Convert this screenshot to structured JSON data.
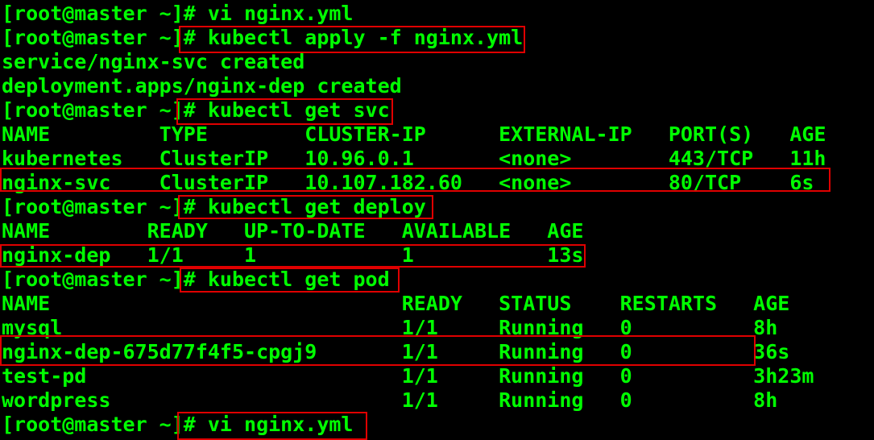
{
  "terminal": {
    "prompt": "[root@master ~]",
    "lines": [
      "[root@master ~]# vi nginx.yml",
      "[root@master ~]# kubectl apply -f nginx.yml",
      "service/nginx-svc created",
      "deployment.apps/nginx-dep created",
      "[root@master ~]# kubectl get svc",
      "NAME         TYPE        CLUSTER-IP      EXTERNAL-IP   PORT(S)   AGE",
      "kubernetes   ClusterIP   10.96.0.1       <none>        443/TCP   11h",
      "nginx-svc    ClusterIP   10.107.182.60   <none>        80/TCP    6s",
      "[root@master ~]# kubectl get deploy",
      "NAME        READY   UP-TO-DATE   AVAILABLE   AGE",
      "nginx-dep   1/1     1            1           13s",
      "[root@master ~]# kubectl get pod",
      "NAME                             READY   STATUS    RESTARTS   AGE",
      "mysql                            1/1     Running   0          8h",
      "nginx-dep-675d77f4f5-cpgj9       1/1     Running   0          36s",
      "test-pd                          1/1     Running   0          3h23m",
      "wordpress                        1/1     Running   0          8h",
      "[root@master ~]# vi nginx.yml"
    ]
  },
  "colors": {
    "background": "#000000",
    "text": "#00ff00",
    "highlight": "#e00000"
  }
}
